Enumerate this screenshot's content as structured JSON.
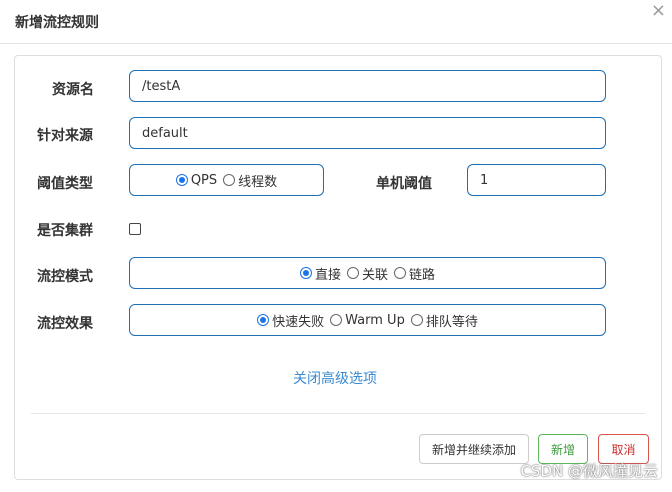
{
  "dialog": {
    "title": "新增流控规则",
    "close_glyph": "×"
  },
  "form": {
    "resource": {
      "label": "资源名",
      "value": "/testA"
    },
    "origin": {
      "label": "针对来源",
      "value": "default"
    },
    "threshold_type": {
      "label": "阈值类型",
      "options": [
        "QPS",
        "线程数"
      ],
      "selected": "QPS"
    },
    "single_threshold": {
      "label": "单机阈值",
      "value": "1"
    },
    "cluster": {
      "label": "是否集群",
      "checked": false
    },
    "flow_mode": {
      "label": "流控模式",
      "options": [
        "直接",
        "关联",
        "链路"
      ],
      "selected": "直接"
    },
    "flow_effect": {
      "label": "流控效果",
      "options": [
        "快速失败",
        "Warm Up",
        "排队等待"
      ],
      "selected": "快速失败"
    },
    "advanced_link": "关闭高级选项"
  },
  "footer": {
    "add_continue_label": "新增并继续添加",
    "add_label": "新增",
    "cancel_label": "取消"
  },
  "watermark": "CSDN @微风撞见云",
  "colors": {
    "input_border": "#1e6fb3",
    "link": "#3a8bd0",
    "success": "#5cb85c",
    "danger": "#d9534f",
    "radio_checked": "#1a73e8"
  }
}
